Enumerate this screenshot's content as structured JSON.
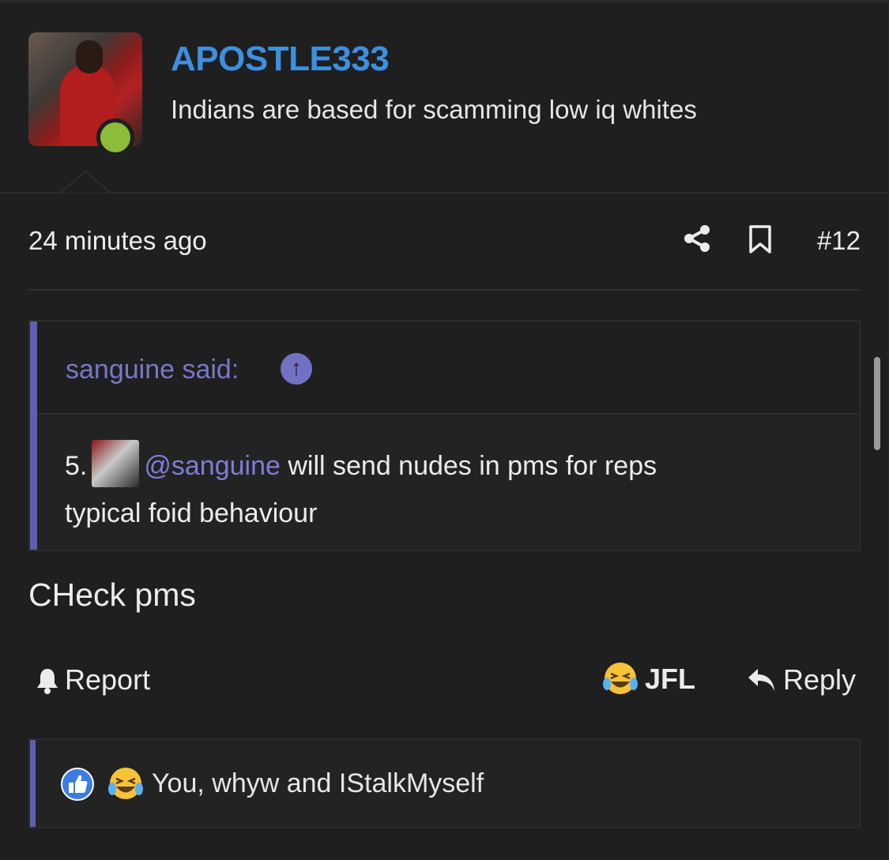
{
  "post": {
    "username": "APOSTLE333",
    "user_title": "Indians are based for scamming low iq whites",
    "online_status": "online",
    "timestamp": "24 minutes ago",
    "post_number": "#12",
    "message": "CHeck pms"
  },
  "quote": {
    "author_label": "sanguine said:",
    "line1_prefix": "5.",
    "mention": "@sanguine",
    "line1_suffix": " will send nudes in pms for reps",
    "line2": "typical foid behaviour"
  },
  "actions": {
    "report_label": "Report",
    "jfl_label": "JFL",
    "reply_label": "Reply"
  },
  "reactions": {
    "summary": "You, whyw and IStalkMyself",
    "icons": [
      "like-icon",
      "laughing-crying-emoji-icon"
    ]
  },
  "colors": {
    "background": "#1f1f1f",
    "username": "#3d8fe0",
    "quote_accent": "#5c5fb3",
    "mention": "#7e7ed6",
    "online": "#8dbb3a"
  }
}
